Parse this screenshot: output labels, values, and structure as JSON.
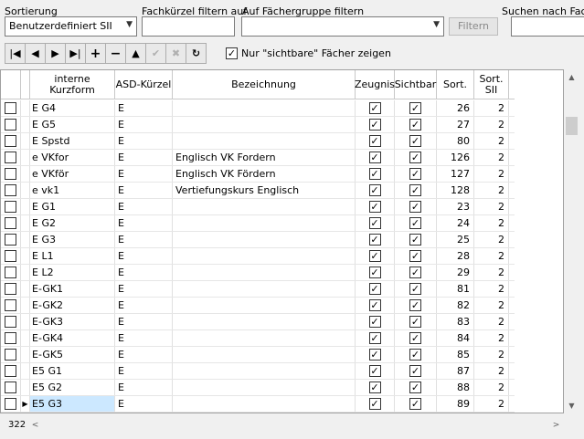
{
  "filters": {
    "sort_label": "Sortierung",
    "sort_value": "Benutzerdefiniert SII",
    "kuerzel_label": "Fachkürzel filtern auf",
    "kuerzel_value": "",
    "gruppe_label": "Auf Fächergruppe filtern",
    "gruppe_value": "",
    "filter_button": "Filtern",
    "search_label": "Suchen nach Fach",
    "search_value": ""
  },
  "toolbar": {
    "first": "|◀",
    "prev": "◀",
    "next": "▶",
    "last": "▶|",
    "insert": "+",
    "delete": "−",
    "edit": "▲",
    "post": "✔",
    "cancel": "✖",
    "refresh": "↻",
    "visible_only_label": "Nur \"sichtbare\" Fächer zeigen",
    "visible_only_checked": true
  },
  "grid": {
    "headers": {
      "kurzform": "interne Kurzform",
      "asd": "ASD-Kürzel",
      "bezeichnung": "Bezeichnung",
      "zeugnis": "Zeugnis",
      "sichtbar": "Sichtbar",
      "sort": "Sort.",
      "sort_sii": "Sort. SII"
    },
    "rows": [
      {
        "kurzform": "E  G4",
        "asd": "E",
        "bezeichnung": "",
        "sort": "26",
        "sort_sii": "2"
      },
      {
        "kurzform": "E  G5",
        "asd": "E",
        "bezeichnung": "",
        "sort": "27",
        "sort_sii": "2"
      },
      {
        "kurzform": "E Spstd",
        "asd": "E",
        "bezeichnung": "",
        "sort": "80",
        "sort_sii": "2"
      },
      {
        "kurzform": "e VKfor",
        "asd": "E",
        "bezeichnung": "Englisch VK Fordern",
        "sort": "126",
        "sort_sii": "2"
      },
      {
        "kurzform": "e VKför",
        "asd": "E",
        "bezeichnung": "Englisch VK Fördern",
        "sort": "127",
        "sort_sii": "2"
      },
      {
        "kurzform": "e vk1",
        "asd": "E",
        "bezeichnung": "Vertiefungskurs Englisch",
        "sort": "128",
        "sort_sii": "2"
      },
      {
        "kurzform": "E  G1",
        "asd": "E",
        "bezeichnung": "",
        "sort": "23",
        "sort_sii": "2"
      },
      {
        "kurzform": "E  G2",
        "asd": "E",
        "bezeichnung": "",
        "sort": "24",
        "sort_sii": "2"
      },
      {
        "kurzform": "E  G3",
        "asd": "E",
        "bezeichnung": "",
        "sort": "25",
        "sort_sii": "2"
      },
      {
        "kurzform": "E  L1",
        "asd": "E",
        "bezeichnung": "",
        "sort": "28",
        "sort_sii": "2"
      },
      {
        "kurzform": "E  L2",
        "asd": "E",
        "bezeichnung": "",
        "sort": "29",
        "sort_sii": "2"
      },
      {
        "kurzform": "E-GK1",
        "asd": "E",
        "bezeichnung": "",
        "sort": "81",
        "sort_sii": "2"
      },
      {
        "kurzform": "E-GK2",
        "asd": "E",
        "bezeichnung": "",
        "sort": "82",
        "sort_sii": "2"
      },
      {
        "kurzform": "E-GK3",
        "asd": "E",
        "bezeichnung": "",
        "sort": "83",
        "sort_sii": "2"
      },
      {
        "kurzform": "E-GK4",
        "asd": "E",
        "bezeichnung": "",
        "sort": "84",
        "sort_sii": "2"
      },
      {
        "kurzform": "E-GK5",
        "asd": "E",
        "bezeichnung": "",
        "sort": "85",
        "sort_sii": "2"
      },
      {
        "kurzform": "E5 G1",
        "asd": "E",
        "bezeichnung": "",
        "sort": "87",
        "sort_sii": "2"
      },
      {
        "kurzform": "E5 G2",
        "asd": "E",
        "bezeichnung": "",
        "sort": "88",
        "sort_sii": "2"
      },
      {
        "kurzform": "E5 G3",
        "asd": "E",
        "bezeichnung": "",
        "sort": "89",
        "sort_sii": "2",
        "selected": true
      }
    ]
  },
  "status": {
    "record_count": "322"
  }
}
